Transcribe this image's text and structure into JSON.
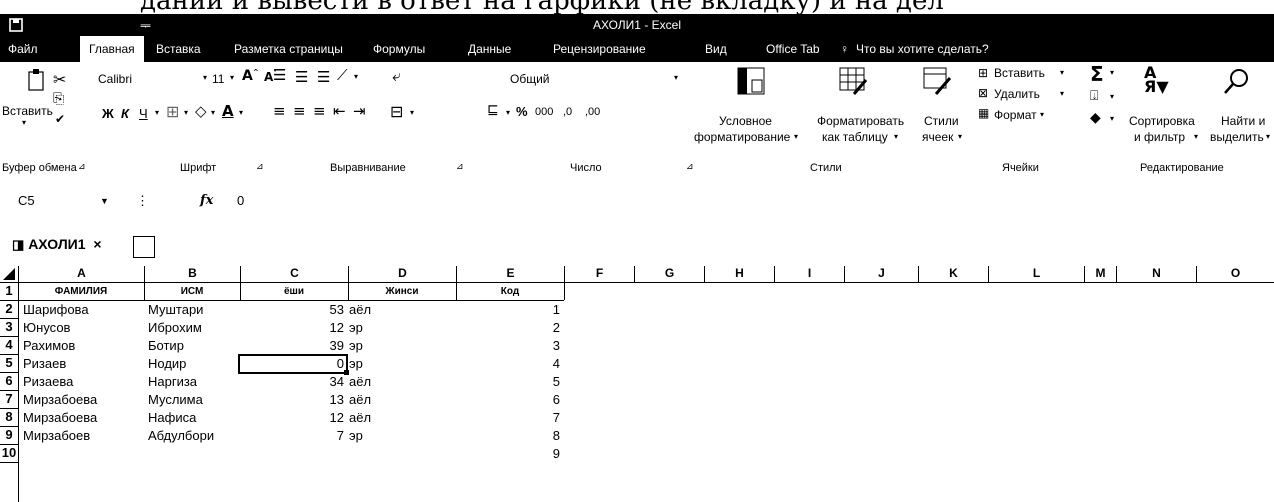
{
  "top_strip": "дании и вывести в ответ на гарфики (не вкладку) и на дел",
  "window": {
    "title": "АХОЛИ1 - Excel"
  },
  "tabs": [
    "Файл",
    "Главная",
    "Вставка",
    "Разметка страницы",
    "Формулы",
    "Данные",
    "Рецензирование",
    "Вид",
    "Office Tab",
    "Что вы хотите сделать?"
  ],
  "ribbon": {
    "clipboard": {
      "paste": "Вставить",
      "group": "Буфер обмена"
    },
    "font": {
      "name": "Calibri",
      "size": "11",
      "bold": "Ж",
      "italic": "К",
      "underline": "Ч",
      "group": "Шрифт"
    },
    "alignment": {
      "group": "Выравнивание"
    },
    "number": {
      "format": "Общий",
      "percent": "%",
      "thousands": "000",
      "inc_dec": ",0",
      "dec_dec": ",00",
      "group": "Число"
    },
    "styles": {
      "conditional_1": "Условное",
      "conditional_2": "форматирование",
      "format_table_1": "Форматировать",
      "format_table_2": "как таблицу",
      "cell_styles_1": "Стили",
      "cell_styles_2": "ячеек",
      "group": "Стили"
    },
    "cells": {
      "insert": "Вставить",
      "delete": "Удалить",
      "format": "Формат",
      "group": "Ячейки"
    },
    "editing": {
      "sum": "Σ",
      "sort_1": "Сортировка",
      "sort_2": "и фильтр",
      "find_1": "Найти и",
      "find_2": "выделить",
      "group": "Редактирование"
    }
  },
  "formula_bar": {
    "name_box": "C5",
    "fx": "fx",
    "value": "0"
  },
  "sheet_tab": {
    "label": "АХОЛИ1",
    "close": "×"
  },
  "columns": [
    "A",
    "B",
    "C",
    "D",
    "E",
    "F",
    "G",
    "H",
    "I",
    "J",
    "K",
    "L",
    "M",
    "N",
    "O"
  ],
  "rows": [
    "1",
    "2",
    "3",
    "4",
    "5",
    "6",
    "7",
    "8",
    "9",
    "10"
  ],
  "header_row": [
    "ФАМИЛИЯ",
    "ИСМ",
    "ёши",
    "Жинси",
    "Код"
  ],
  "data_rows": [
    [
      "Шарифова",
      "Муштари",
      "53",
      "аёл",
      "1"
    ],
    [
      "Юнусов",
      "Иброхим",
      "12",
      "эр",
      "2"
    ],
    [
      "Рахимов",
      "Ботир",
      "39",
      "эр",
      "3"
    ],
    [
      "Ризаев",
      "Нодир",
      "0",
      "эр",
      "4"
    ],
    [
      "Ризаева",
      "Наргиза",
      "34",
      "аёл",
      "5"
    ],
    [
      "Мирзабоева",
      "Муслима",
      "13",
      "аёл",
      "6"
    ],
    [
      "Мирзабоева",
      "Нафиса",
      "12",
      "аёл",
      "7"
    ],
    [
      "Мирзабоев",
      "Абдулбори",
      "7",
      "эр",
      "8"
    ],
    [
      "",
      "",
      "",
      "",
      "9"
    ]
  ]
}
